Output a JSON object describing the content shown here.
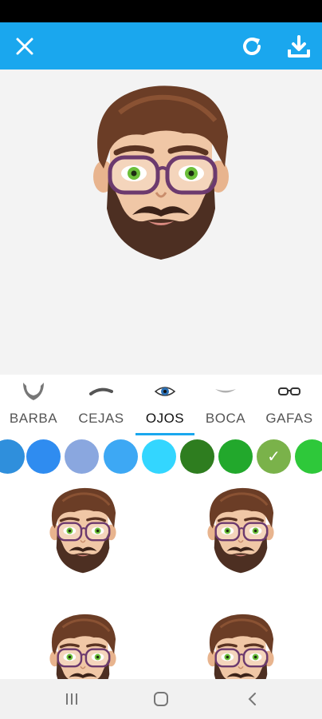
{
  "toolbar": {
    "bg_color": "#1aa7ee",
    "close_icon": "close-icon",
    "refresh_icon": "refresh-icon",
    "download_icon": "download-icon"
  },
  "tabs": [
    {
      "label": "BARBA",
      "icon": "beard-icon"
    },
    {
      "label": "CEJAS",
      "icon": "eyebrow-icon"
    },
    {
      "label": "OJOS",
      "icon": "eye-icon",
      "active": true
    },
    {
      "label": "BOCA",
      "icon": "mouth-icon"
    },
    {
      "label": "GAFAS",
      "icon": "glasses-icon"
    }
  ],
  "eye_colors": [
    "#2f8fdc",
    "#2f8cf0",
    "#8aa7df",
    "#3da8f4",
    "#33d6ff",
    "#2e7d1f",
    "#22a82c",
    "#7ab24a",
    "#2ec83a"
  ],
  "selected_color_index": 7,
  "selected_mark": "✓",
  "nav": {
    "recents_icon": "recents-icon",
    "home_icon": "home-icon",
    "back_icon": "back-icon"
  }
}
